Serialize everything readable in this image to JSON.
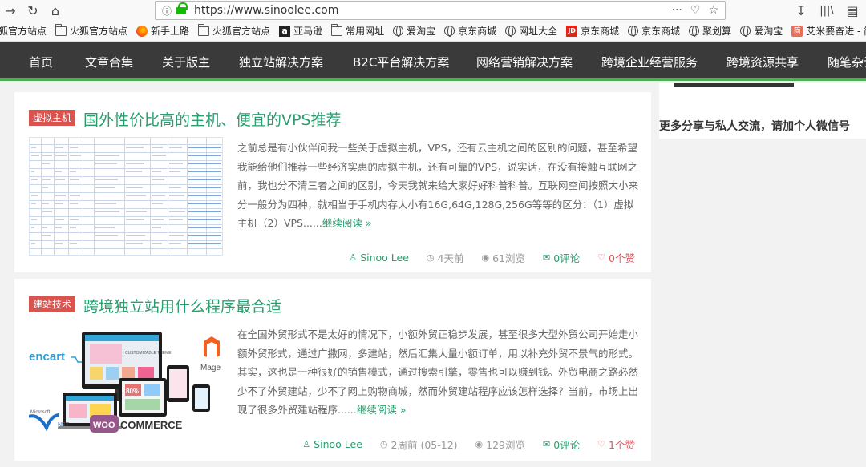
{
  "browser": {
    "url": "https://www.sinoolee.com",
    "bookmarks": [
      {
        "label": "狐官方站点",
        "icon": "folder-icon"
      },
      {
        "label": "火狐官方站点",
        "icon": "folder-icon"
      },
      {
        "label": "新手上路",
        "icon": "firefox-icon"
      },
      {
        "label": "火狐官方站点",
        "icon": "folder-icon"
      },
      {
        "label": "亚马逊",
        "icon": "amazon-icon"
      },
      {
        "label": "常用网址",
        "icon": "folder-icon"
      },
      {
        "label": "爱淘宝",
        "icon": "globe-icon"
      },
      {
        "label": "京东商城",
        "icon": "globe-icon"
      },
      {
        "label": "网址大全",
        "icon": "globe-icon"
      },
      {
        "label": "京东商城",
        "icon": "jd-icon"
      },
      {
        "label": "京东商城",
        "icon": "globe-icon"
      },
      {
        "label": "聚划算",
        "icon": "globe-icon"
      },
      {
        "label": "爱淘宝",
        "icon": "globe-icon"
      },
      {
        "label": "艾米要奋进 - 简书",
        "icon": "jianshu-icon"
      }
    ]
  },
  "nav": {
    "items": [
      "首页",
      "文章合集",
      "关于版主",
      "独立站解决方案",
      "B2C平台解决方案",
      "网络营销解决方案",
      "跨境企业经营服务",
      "跨境资源共享",
      "随笔杂谈"
    ]
  },
  "posts": [
    {
      "category": "虚拟主机",
      "title": "国外性价比高的主机、便宜的VPS推荐",
      "excerpt": "之前总是有小伙伴问我一些关于虚拟主机，VPS，还有云主机之间的区别的问题，甚至希望我能给他们推荐一些经济实惠的虚拟主机，还有可靠的VPS，说实话，在没有接触互联网之前，我也分不清三者之间的区别，今天我就来给大家好好科普科普。互联网空间按照大小来分一般分为四种，就相当于手机内存大小有16G,64G,128G,256G等等的区分：（1）虚拟主机（2）VPS......",
      "read_more": "继续阅读 »",
      "author": "Sinoo Lee",
      "time": "4天前",
      "views": "61浏览",
      "comments": "0评论",
      "likes": "0个赞"
    },
    {
      "category": "建站技术",
      "title": "跨境独立站用什么程序最合适",
      "excerpt": "在全国外贸形式不是太好的情况下，小额外贸正稳步发展，甚至很多大型外贸公司开始走小额外贸形式，通过广撒网，多建站，然后汇集大量小额订单，用以补充外贸不景气的形式。其实，这也是一种很好的销售模式，通过搜索引擎，零售也可以赚到钱。外贸电商之路必然少不了外贸建站，少不了网上购物商城，然而外贸建站程序应该怎样选择？当前，市场上出现了很多外贸建站程序......",
      "read_more": "继续阅读 »",
      "author": "Sinoo Lee",
      "time": "2周前 (05-12)",
      "views": "129浏览",
      "comments": "0评论",
      "likes": "1个赞"
    }
  ],
  "thumb2": {
    "brand_opencart": "encart",
    "brand_magento": "Mage",
    "brand_microsoft": "Microsoft",
    "brand_net": "NET",
    "brand_woo": "WOO",
    "brand_commerce": "COMMERCE",
    "screen_text": "CUSTOMIZABLE THEME",
    "sale": "80%"
  },
  "sidebar": {
    "text": "更多分享与私人交流，请加个人微信号"
  },
  "colors": {
    "nav_bg": "#3a3a3a",
    "nav_accent": "#4caf50",
    "link_green": "#2a9d6f",
    "category_red": "#d9534f",
    "like_red": "#e0555a"
  }
}
